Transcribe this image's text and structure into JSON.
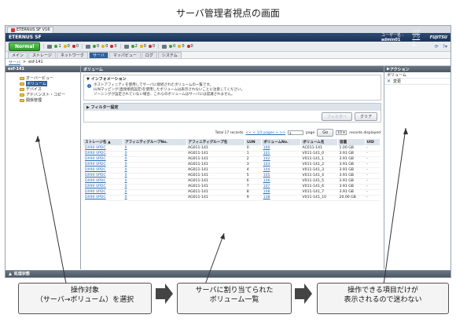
{
  "page_title": "サーバ管理者視点の画面",
  "browser_tab": {
    "label": "ETERNUS SF V16"
  },
  "appbar": {
    "title": "ETERNUS SF",
    "user_label": "ユーザー名",
    "user_name": "admin01",
    "logout": "ログアウト",
    "logo": "FUJITSU"
  },
  "statusbar": {
    "normal": "Normal",
    "groups": [
      {
        "icon": "storage-icon",
        "counts": [
          "1",
          "0",
          "0"
        ]
      },
      {
        "icon": "switch-icon",
        "counts": [
          "0",
          "0",
          "0"
        ]
      },
      {
        "icon": "server-icon",
        "counts": [
          "2",
          "0",
          "0"
        ]
      },
      {
        "icon": "play-icon",
        "counts": [
          "0",
          "0",
          "0"
        ]
      }
    ],
    "colors": {
      "ok": "#2ea52a",
      "warn": "#e0b400",
      "err": "#d52020"
    }
  },
  "menu": [
    "メイン",
    "ストレージ",
    "ネットワーク",
    "サーバ",
    "マッパビュー",
    "ログ",
    "システム"
  ],
  "menu_active": "サーバ",
  "breadcrumb": [
    "サーバ",
    "esf-141"
  ],
  "left_pane": {
    "title": "esf-141",
    "tree": [
      "オーバービュー",
      "ボリューム",
      "デバイス",
      "アドバンスト・コピー",
      "関係管理"
    ],
    "selected": "ボリューム"
  },
  "center": {
    "title": "ボリューム",
    "info_title": "インフォメーション",
    "info_lines": [
      "ホストアフィニティを使用してサーバに接続されたボリュームの一覧です。",
      "LUNマッピング(直接接続設定)を使用したボリュームは表示されないことに注意してください。",
      "ゾーニングが設定されていない場合、これらのボリュームはサーバには認識されません。"
    ],
    "filter_title": "フィルター設定",
    "filter_btn": "フィルター",
    "clear_btn": "クリア",
    "pager": {
      "total": "Total 17 records",
      "nav": "<< < 1/2 pages > >>",
      "page_value": "1",
      "page_label": "page",
      "go": "Go",
      "per_page": "10",
      "displayed": "records displayed"
    },
    "table": {
      "headers": [
        "ストレージ名",
        "アフィニティグループNo.",
        "アフィニティグループ名",
        "LUN",
        "ボリュームNo.",
        "ボリューム名",
        "容量",
        "UID"
      ],
      "rows": [
        [
          "DX90 VPDC",
          "0",
          "AG011-141",
          "0",
          "160",
          "AC011-141",
          "1.00 GB",
          "-"
        ],
        [
          "DX90 VPDC",
          "0",
          "AG011-141",
          "1",
          "101",
          "V011-141_0",
          "3.91 GB",
          "-"
        ],
        [
          "DX90 VPDC",
          "0",
          "AG011-141",
          "2",
          "102",
          "V011-141_1",
          "3.91 GB",
          "-"
        ],
        [
          "DX90 VPDC",
          "0",
          "AG011-141",
          "3",
          "103",
          "V011-141_2",
          "3.91 GB",
          "-"
        ],
        [
          "DX90 VPDC",
          "0",
          "AG011-141",
          "4",
          "104",
          "V011-141_3",
          "3.91 GB",
          "-"
        ],
        [
          "DX90 VPDC",
          "0",
          "AG011-141",
          "5",
          "105",
          "V011-141_4",
          "3.91 GB",
          "-"
        ],
        [
          "DX90 VPDC",
          "0",
          "AG011-141",
          "6",
          "106",
          "V011-141_5",
          "3.91 GB",
          "-"
        ],
        [
          "DX90 VPDC",
          "0",
          "AG011-141",
          "7",
          "107",
          "V011-141_6",
          "3.91 GB",
          "-"
        ],
        [
          "DX90 VPDC",
          "0",
          "AG011-141",
          "8",
          "108",
          "V011-141_7",
          "3.91 GB",
          "-"
        ],
        [
          "DX90 VPDC",
          "0",
          "AG011-141",
          "9",
          "138",
          "V011-141_10",
          "20.00 GB",
          "-"
        ]
      ]
    }
  },
  "right_pane": {
    "title": "アクション",
    "section": "ボリューム",
    "action": "変更"
  },
  "bottombar": "処理状態",
  "callouts": [
    {
      "line1": "操作対象",
      "line2": "（サーバ→ボリューム）を選択"
    },
    {
      "line1": "サーバに割り当てられた",
      "line2": "ボリューム一覧"
    },
    {
      "line1": "操作できる項目だけが",
      "line2": "表示されるので迷わない"
    }
  ]
}
